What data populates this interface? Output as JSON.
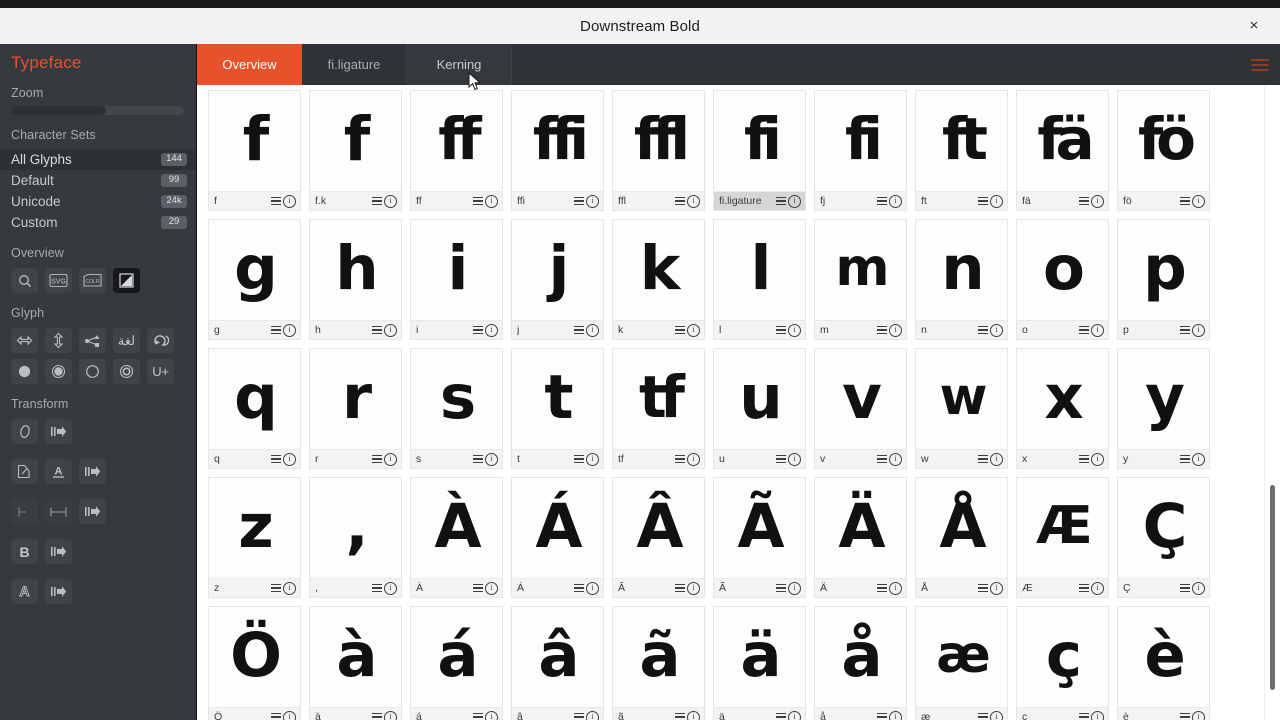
{
  "window": {
    "title": "Downstream Bold",
    "close_label": "×"
  },
  "sidebar": {
    "brand": "Typeface",
    "zoom": {
      "label": "Zoom",
      "value_percent": 55
    },
    "character_sets": {
      "label": "Character Sets",
      "items": [
        {
          "label": "All Glyphs",
          "count": "144",
          "active": true
        },
        {
          "label": "Default",
          "count": "99",
          "active": false
        },
        {
          "label": "Unicode",
          "count": "24k",
          "active": false
        },
        {
          "label": "Custom",
          "count": "29",
          "active": false
        }
      ]
    },
    "overview": {
      "label": "Overview",
      "tools": [
        {
          "name": "search-icon",
          "selected": false
        },
        {
          "name": "svg-icon",
          "selected": false,
          "text": "SVG"
        },
        {
          "name": "colr-icon",
          "selected": false,
          "text": "COLR"
        },
        {
          "name": "filled-preview-icon",
          "selected": true
        }
      ]
    },
    "glyph": {
      "label": "Glyph",
      "tools_row1": [
        {
          "name": "flip-horizontal-icon"
        },
        {
          "name": "flip-vertical-icon"
        },
        {
          "name": "share-nodes-icon"
        },
        {
          "name": "arabic-script-icon",
          "text": "لغة"
        },
        {
          "name": "rotate-icon"
        }
      ],
      "tools_row2": [
        {
          "name": "half-fill-icon"
        },
        {
          "name": "filled-circle-icon"
        },
        {
          "name": "outline-circle-icon"
        },
        {
          "name": "ring-circle-icon"
        },
        {
          "name": "unicode-codepoint-icon",
          "text": "U+"
        }
      ]
    },
    "transform": {
      "label": "Transform",
      "rows": [
        [
          {
            "name": "italic-oblique-icon",
            "text": "O"
          },
          {
            "name": "apply-arrow-icon"
          }
        ],
        [
          {
            "name": "scale-corner-icon"
          },
          {
            "name": "baseline-align-icon",
            "text": "A"
          },
          {
            "name": "apply-arrow-icon"
          }
        ],
        [
          {
            "name": "left-sidebearing-icon"
          },
          {
            "name": "advance-width-icon"
          },
          {
            "name": "apply-arrow-icon"
          }
        ],
        [
          {
            "name": "embolden-icon",
            "text": "B"
          },
          {
            "name": "apply-arrow-icon"
          }
        ],
        [
          {
            "name": "outline-stroke-icon",
            "text": "A"
          },
          {
            "name": "apply-arrow-icon"
          }
        ]
      ]
    }
  },
  "tabs": [
    {
      "label": "Overview",
      "state": "active"
    },
    {
      "label": "fi.ligature",
      "state": "normal"
    },
    {
      "label": "Kerning",
      "state": "hover"
    }
  ],
  "menu_button": {
    "name": "hamburger-menu-icon"
  },
  "glyph_grid": {
    "columns": 10,
    "cell_icons": {
      "menu": "hamburger-icon",
      "info": "info-icon"
    },
    "cells": [
      {
        "glyph": "f",
        "name": "f",
        "display": "f",
        "style": ""
      },
      {
        "glyph": "f",
        "name": "f.k",
        "display": "f",
        "style": ""
      },
      {
        "glyph": "ff",
        "name": "ff",
        "display": "ff",
        "style": "lig"
      },
      {
        "glyph": "ffi",
        "name": "ffi",
        "display": "ffi",
        "style": "lig"
      },
      {
        "glyph": "ffl",
        "name": "ffl",
        "display": "ffl",
        "style": "lig"
      },
      {
        "glyph": "fi",
        "name": "fi.ligature",
        "display": "fi",
        "style": "lig",
        "selected": true
      },
      {
        "glyph": "fj",
        "name": "fj",
        "display": "fi",
        "style": "lig"
      },
      {
        "glyph": "ft",
        "name": "ft",
        "display": "ft",
        "style": "lig"
      },
      {
        "glyph": "fä",
        "name": "fä",
        "display": "fä",
        "style": "lig"
      },
      {
        "glyph": "fö",
        "name": "fö",
        "display": "fö",
        "style": "lig"
      },
      {
        "glyph": "g",
        "name": "g",
        "display": "g",
        "style": ""
      },
      {
        "glyph": "h",
        "name": "h",
        "display": "h",
        "style": ""
      },
      {
        "glyph": "i",
        "name": "i",
        "display": "i",
        "style": ""
      },
      {
        "glyph": "j",
        "name": "j",
        "display": "j",
        "style": ""
      },
      {
        "glyph": "k",
        "name": "k",
        "display": "k",
        "style": ""
      },
      {
        "glyph": "l",
        "name": "l",
        "display": "l",
        "style": ""
      },
      {
        "glyph": "m",
        "name": "m",
        "display": "m",
        "style": "wide"
      },
      {
        "glyph": "n",
        "name": "n",
        "display": "n",
        "style": ""
      },
      {
        "glyph": "o",
        "name": "o",
        "display": "o",
        "style": ""
      },
      {
        "glyph": "p",
        "name": "p",
        "display": "p",
        "style": ""
      },
      {
        "glyph": "q",
        "name": "q",
        "display": "q",
        "style": ""
      },
      {
        "glyph": "r",
        "name": "r",
        "display": "r",
        "style": ""
      },
      {
        "glyph": "s",
        "name": "s",
        "display": "s",
        "style": ""
      },
      {
        "glyph": "t",
        "name": "t",
        "display": "t",
        "style": ""
      },
      {
        "glyph": "tf",
        "name": "tf",
        "display": "tf",
        "style": "lig"
      },
      {
        "glyph": "u",
        "name": "u",
        "display": "u",
        "style": ""
      },
      {
        "glyph": "v",
        "name": "v",
        "display": "v",
        "style": ""
      },
      {
        "glyph": "w",
        "name": "w",
        "display": "w",
        "style": "wide"
      },
      {
        "glyph": "x",
        "name": "x",
        "display": "x",
        "style": ""
      },
      {
        "glyph": "y",
        "name": "y",
        "display": "y",
        "style": ""
      },
      {
        "glyph": "z",
        "name": "z",
        "display": "z",
        "style": ""
      },
      {
        "glyph": ",",
        "name": ",",
        "display": ",",
        "style": ""
      },
      {
        "glyph": "À",
        "name": "À",
        "display": "À",
        "style": ""
      },
      {
        "glyph": "Á",
        "name": "Á",
        "display": "Á",
        "style": ""
      },
      {
        "glyph": "Â",
        "name": "Â",
        "display": "Â",
        "style": ""
      },
      {
        "glyph": "Ã",
        "name": "Ã",
        "display": "Ã",
        "style": ""
      },
      {
        "glyph": "Ä",
        "name": "Ä",
        "display": "Ä",
        "style": ""
      },
      {
        "glyph": "Å",
        "name": "Å",
        "display": "Å",
        "style": ""
      },
      {
        "glyph": "Æ",
        "name": "Æ",
        "display": "Æ",
        "style": "wide"
      },
      {
        "glyph": "Ç",
        "name": "Ç",
        "display": "Ç",
        "style": ""
      },
      {
        "glyph": "Ö",
        "name": "Ö",
        "display": "Ö",
        "style": ""
      },
      {
        "glyph": "à",
        "name": "à",
        "display": "à",
        "style": ""
      },
      {
        "glyph": "á",
        "name": "á",
        "display": "á",
        "style": ""
      },
      {
        "glyph": "â",
        "name": "â",
        "display": "â",
        "style": ""
      },
      {
        "glyph": "ã",
        "name": "ã",
        "display": "ã",
        "style": ""
      },
      {
        "glyph": "ä",
        "name": "ä",
        "display": "ä",
        "style": ""
      },
      {
        "glyph": "å",
        "name": "å",
        "display": "å",
        "style": ""
      },
      {
        "glyph": "æ",
        "name": "æ",
        "display": "æ",
        "style": "wide"
      },
      {
        "glyph": "ç",
        "name": "ç",
        "display": "ç",
        "style": ""
      },
      {
        "glyph": "è",
        "name": "è",
        "display": "è",
        "style": ""
      }
    ]
  },
  "colors": {
    "accent": "#e8522a",
    "sidebar_bg": "#36393d",
    "tabbar_bg": "#2f3236",
    "grid_bg": "#ffffff"
  }
}
